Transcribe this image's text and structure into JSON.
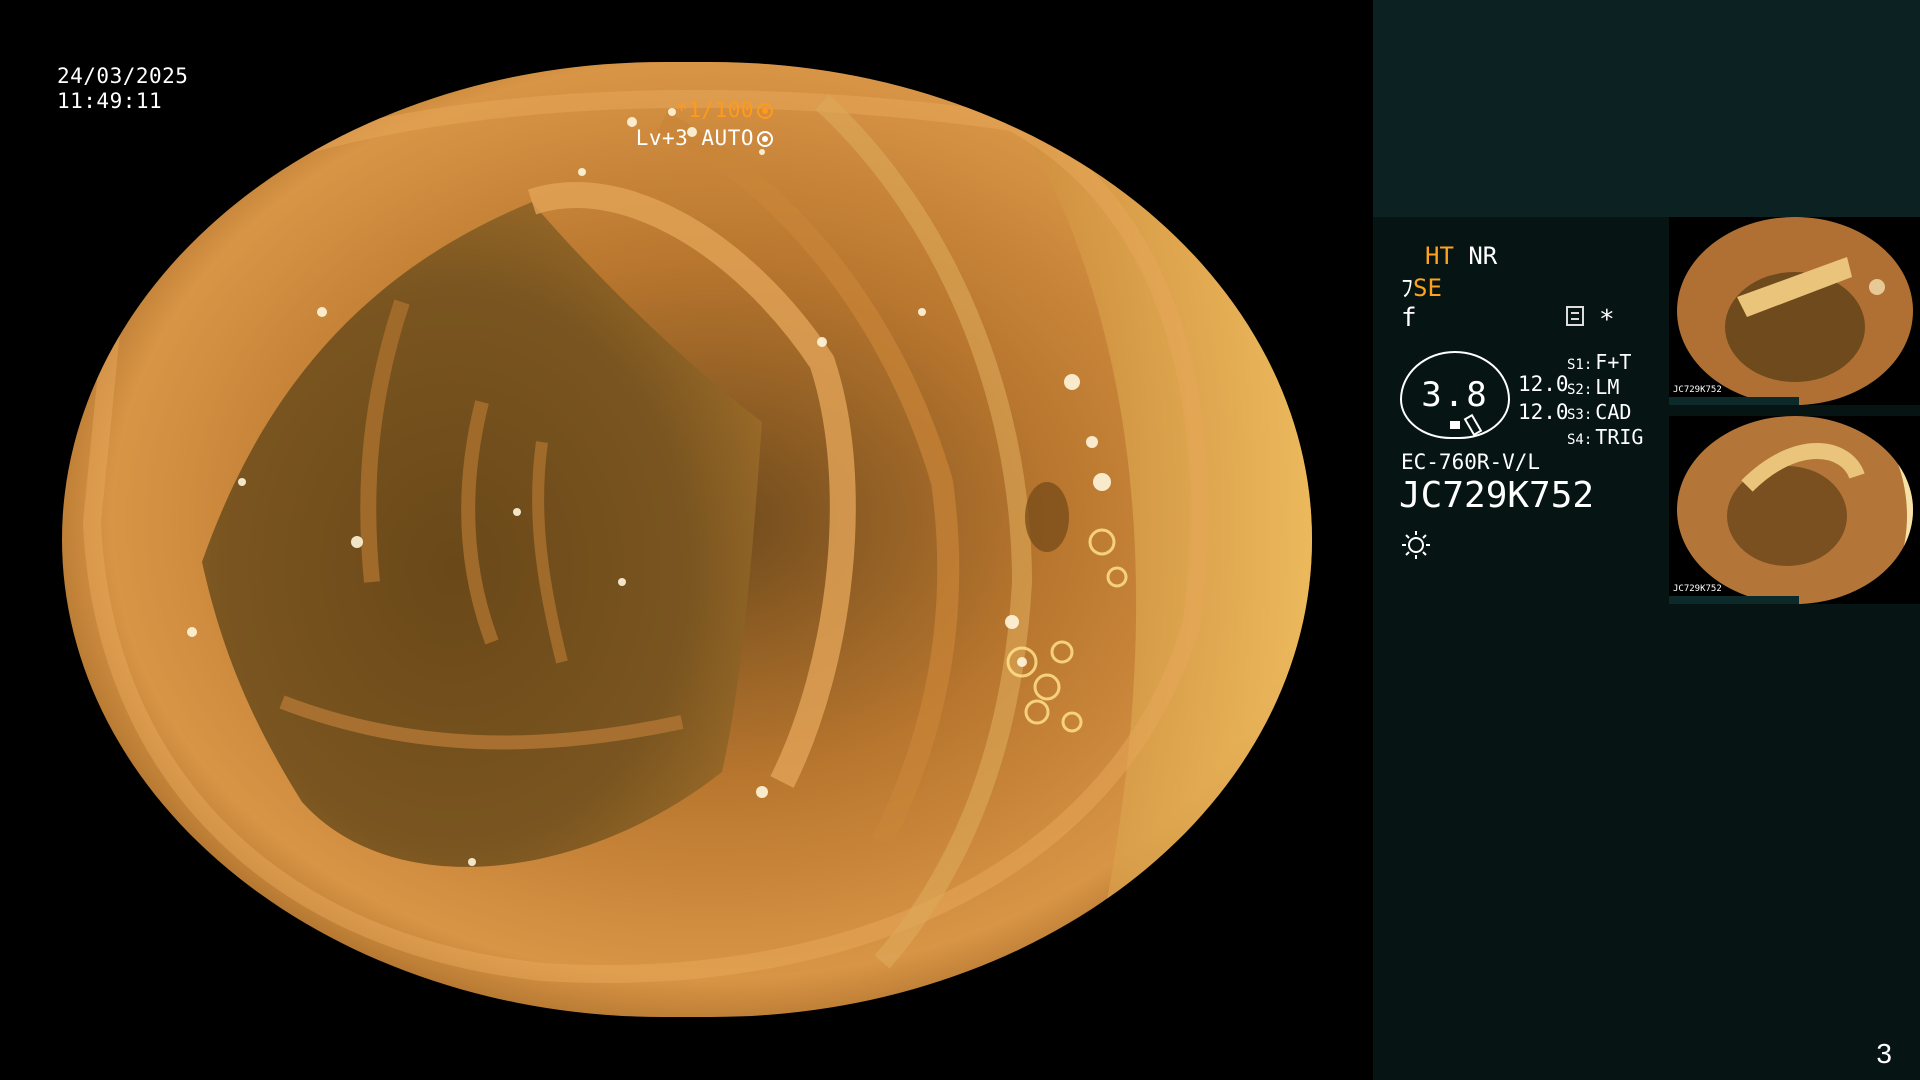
{
  "overlay": {
    "date": "24/03/2025",
    "time": "11:49:11",
    "shutter": "*1/100",
    "level": "Lv+3 AUTO"
  },
  "panel": {
    "ht": "HT",
    "nr": "NR",
    "se": "SE",
    "f_symbol": "f",
    "star": "*",
    "gauge_value": "3.8",
    "value_1": "12.0",
    "value_2": "12.0",
    "switches": [
      {
        "key": "S1:",
        "value": "F+T"
      },
      {
        "key": "S2:",
        "value": "LM"
      },
      {
        "key": "S3:",
        "value": "CAD"
      },
      {
        "key": "S4:",
        "value": "TRIG"
      }
    ],
    "scope_model": "EC-760R-V/L",
    "scope_serial": "JC729K752"
  },
  "thumbnails": [
    {
      "label": "JC729K752"
    },
    {
      "label": "JC729K752"
    }
  ],
  "page_number": "3",
  "colors": {
    "accent_orange": "#ffa21e",
    "panel_bg": "#061414",
    "panel_top": "#0c2121"
  },
  "icons": [
    "shutter-icon",
    "auto-iris-icon",
    "settings-icon",
    "light-icon"
  ]
}
